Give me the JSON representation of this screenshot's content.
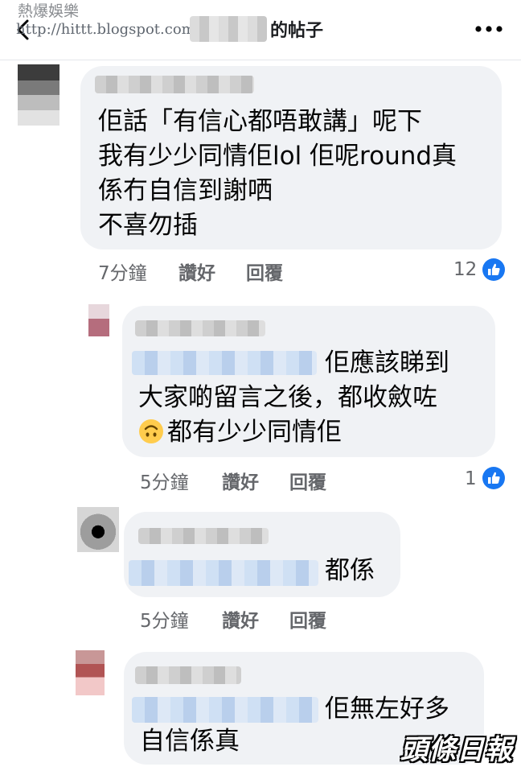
{
  "watermark": {
    "site_name": "熱爆娛樂",
    "url": "http://hittt.blogspot.com"
  },
  "header": {
    "title": "的帖子"
  },
  "comments": [
    {
      "lines": [
        "佢話「有信心都唔敢講」呢下",
        "我有少少同情佢lol 佢呢round真",
        "係冇自信到謝哂",
        "不喜勿插"
      ],
      "time": "7分鐘",
      "like_label": "讚好",
      "reply_label": "回覆",
      "reaction_count": "12"
    },
    {
      "lines": [
        "佢應該睇到",
        "大家啲留言之後，都收斂咗",
        "都有少少同情佢"
      ],
      "emoji": "upside-down-face-icon",
      "time": "5分鐘",
      "like_label": "讚好",
      "reply_label": "回覆",
      "reaction_count": "1"
    },
    {
      "lines": [
        "都係"
      ],
      "time": "5分鐘",
      "like_label": "讚好",
      "reply_label": "回覆"
    },
    {
      "lines": [
        "佢無左好多",
        "自信係真"
      ]
    }
  ],
  "brand_logo": "頭條日報",
  "colors": {
    "like_blue": "#1877f2",
    "bubble_bg": "#f0f2f5",
    "meta_gray": "#65676b"
  }
}
